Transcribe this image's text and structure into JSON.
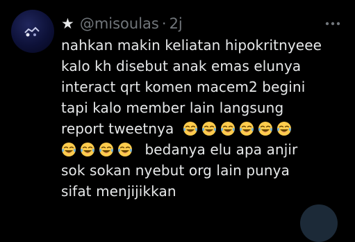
{
  "tweet": {
    "star": "★",
    "handle": "@misoulas",
    "separator": "·",
    "time": "2j",
    "body": {
      "line1": "nahkan makin keliatan hipokritnyeee",
      "line2": "kalo kh disebut anak emas elunya",
      "line3": "interact qrt komen macem2 begini",
      "line4": "tapi kalo member lain langsung",
      "line5a": "report tweetnya",
      "line6b": "bedanya elu apa anjir",
      "line7": "sok sokan nyebut org lain punya",
      "line8": "sifat menjijikkan"
    },
    "emoji_name": "face-with-tears-of-joy-icon",
    "emoji_row1_count": 6,
    "emoji_row2_count": 4
  },
  "colors": {
    "background": "#000000",
    "text_primary": "#e7e9ea",
    "text_secondary": "#71767b"
  }
}
